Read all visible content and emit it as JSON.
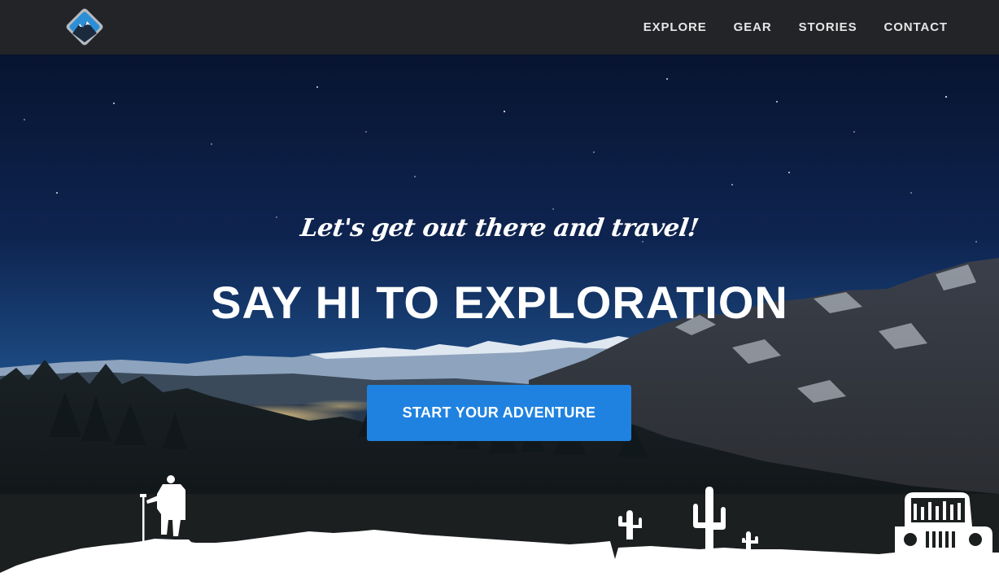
{
  "navbar": {
    "logo_icon": "mountain-logo-icon",
    "links": [
      {
        "label": "EXPLORE"
      },
      {
        "label": "GEAR"
      },
      {
        "label": "STORIES"
      },
      {
        "label": "CONTACT"
      }
    ]
  },
  "hero": {
    "tagline": "Let's get out there and travel!",
    "headline": "SAY HI TO EXPLORATION",
    "cta_label": "START YOUR ADVENTURE",
    "background": "night-mountain-landscape",
    "silhouettes": [
      "hiker-silhouette",
      "cactus-silhouette",
      "jeep-silhouette",
      "mountain-ground-silhouette"
    ]
  },
  "colors": {
    "navbar_bg": "#222428",
    "cta_bg": "#1f82e0",
    "sky_top": "#0b1734",
    "sky_bottom": "#1d4478",
    "text": "#ffffff"
  }
}
